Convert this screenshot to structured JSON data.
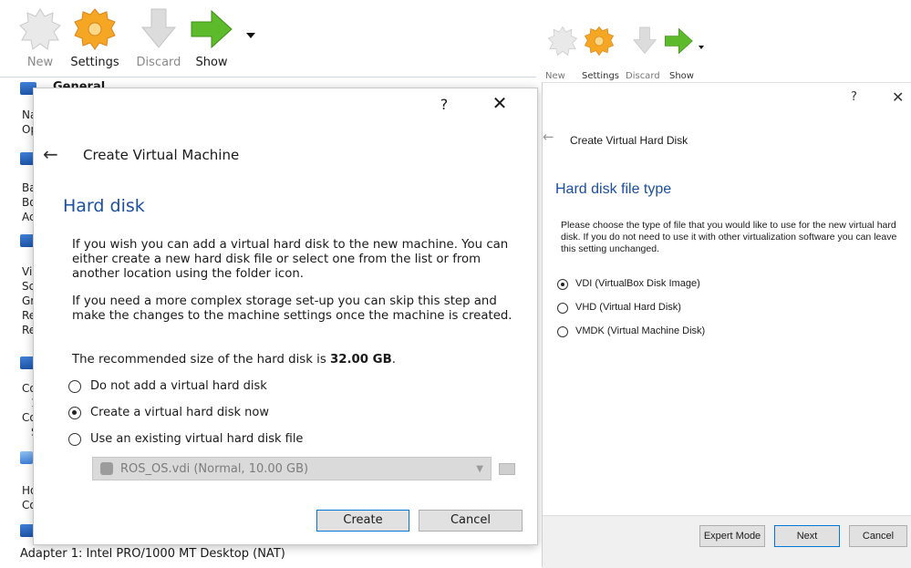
{
  "manager": {
    "toolbar": {
      "new_label": "New",
      "settings_label": "Settings",
      "discard_label": "Discard",
      "show_label": "Show"
    },
    "general_title": "General",
    "side_fragments": [
      "Na",
      "Op",
      "Ba",
      "Bo",
      "Ac",
      "Vi",
      "Sc",
      "Gr",
      "Re",
      "Re",
      "Co",
      "1",
      "Co",
      "S",
      "Ho",
      "Co"
    ],
    "adapter_line": "Adapter 1:   Intel PRO/1000 MT Desktop (NAT)"
  },
  "create_vm_dialog": {
    "help_label": "?",
    "close_label": "✕",
    "back_label": "←",
    "breadcrumb": "Create Virtual Machine",
    "heading": "Hard disk",
    "para1": "If you wish you can add a virtual hard disk to the new machine. You can either create a new hard disk file or select one from the list or from another location using the folder icon.",
    "para2": "If you need a more complex storage set-up you can skip this step and make the changes to the machine settings once the machine is created.",
    "recommended_prefix": "The recommended size of the hard disk is ",
    "recommended_size": "32.00 GB",
    "recommended_suffix": ".",
    "options": [
      {
        "label": "Do not add a virtual hard disk",
        "selected": false
      },
      {
        "label": "Create a virtual hard disk now",
        "selected": true
      },
      {
        "label": "Use an existing virtual hard disk file",
        "selected": false
      }
    ],
    "existing_disk_value": "ROS_OS.vdi (Normal, 10.00 GB)",
    "create_label": "Create",
    "cancel_label": "Cancel"
  },
  "hard_disk_wizard": {
    "toolbar": {
      "new_label": "New",
      "settings_label": "Settings",
      "discard_label": "Discard",
      "show_label": "Show"
    },
    "help_label": "?",
    "close_label": "✕",
    "back_label": "←",
    "breadcrumb": "Create Virtual Hard Disk",
    "heading": "Hard disk file type",
    "description": "Please choose the type of file that you would like to use for the new virtual hard disk. If you do not need to use it with other virtualization software you can leave this setting unchanged.",
    "options": [
      {
        "label": "VDI (VirtualBox Disk Image)",
        "selected": true
      },
      {
        "label": "VHD (Virtual Hard Disk)",
        "selected": false
      },
      {
        "label": "VMDK (Virtual Machine Disk)",
        "selected": false
      }
    ],
    "expert_mode_label": "Expert Mode",
    "next_label": "Next",
    "cancel_label": "Cancel"
  },
  "colors": {
    "heading_blue": "#1b4fa0",
    "default_button_border": "#0078d7",
    "settings_gear": "#f5a623",
    "show_arrow": "#5dbb2b"
  }
}
